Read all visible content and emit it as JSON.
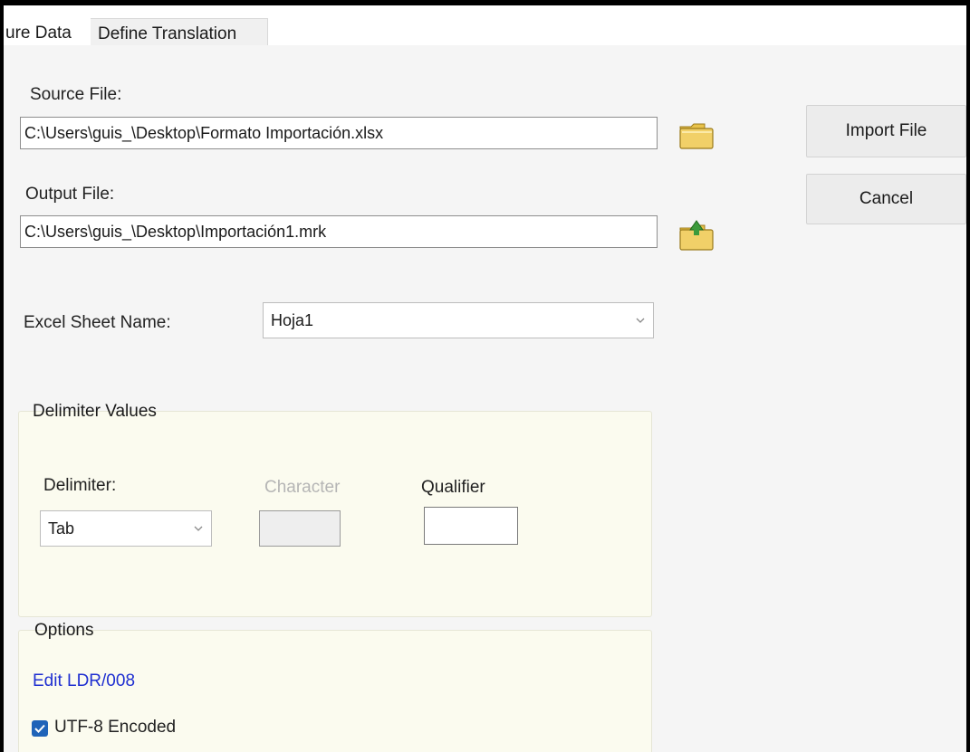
{
  "tabs": [
    {
      "label": "ure Data",
      "active": true
    },
    {
      "label": "Define Translation",
      "active": false
    }
  ],
  "source_file": {
    "label": "Source File:",
    "value": "C:\\Users\\guis_\\Desktop\\Formato Importación.xlsx"
  },
  "output_file": {
    "label": "Output File:",
    "value": "C:\\Users\\guis_\\Desktop\\Importación1.mrk"
  },
  "buttons": {
    "import": "Import File",
    "cancel": "Cancel"
  },
  "excel_sheet": {
    "label": "Excel Sheet Name:",
    "value": "Hoja1"
  },
  "delimiter_group": {
    "title": "Delimiter Values",
    "delimiter_label": "Delimiter:",
    "delimiter_value": "Tab",
    "character_label": "Character",
    "character_value": "",
    "qualifier_label": "Qualifier",
    "qualifier_value": ""
  },
  "options_group": {
    "title": "Options",
    "edit_link": "Edit LDR/008",
    "utf8_label": "UTF-8 Encoded",
    "utf8_checked": true
  },
  "colors": {
    "accent_blue": "#1f63b8",
    "link_blue": "#1f2fd1",
    "group_bg": "#fbfbef",
    "panel_bg": "#f5f5f5"
  },
  "icons": {
    "open_source": "folder-open-icon",
    "open_output": "folder-save-icon",
    "combo_arrow": "chevron-down-icon",
    "check": "checkmark-icon"
  }
}
